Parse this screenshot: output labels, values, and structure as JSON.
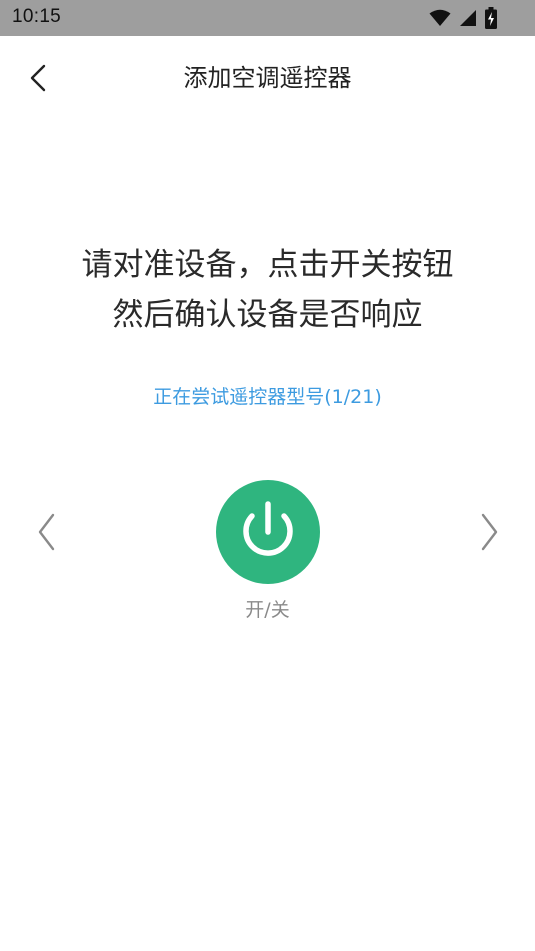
{
  "status_bar": {
    "time": "10:15",
    "icons": [
      "wifi-icon",
      "cell-signal-icon",
      "battery-charging-icon"
    ]
  },
  "header": {
    "back_icon": "chevron-left-icon",
    "title": "添加空调遥控器"
  },
  "instruction": {
    "line1": "请对准设备，点击开关按钮",
    "line2": "然后确认设备是否响应"
  },
  "trying": {
    "text": "正在尝试遥控器型号(1/21)",
    "color": "#3d9be0"
  },
  "controls": {
    "prev_icon": "chevron-left-icon",
    "next_icon": "chevron-right-icon",
    "power_icon": "power-icon",
    "power_label": "开/关",
    "power_color": "#2fb57f"
  }
}
